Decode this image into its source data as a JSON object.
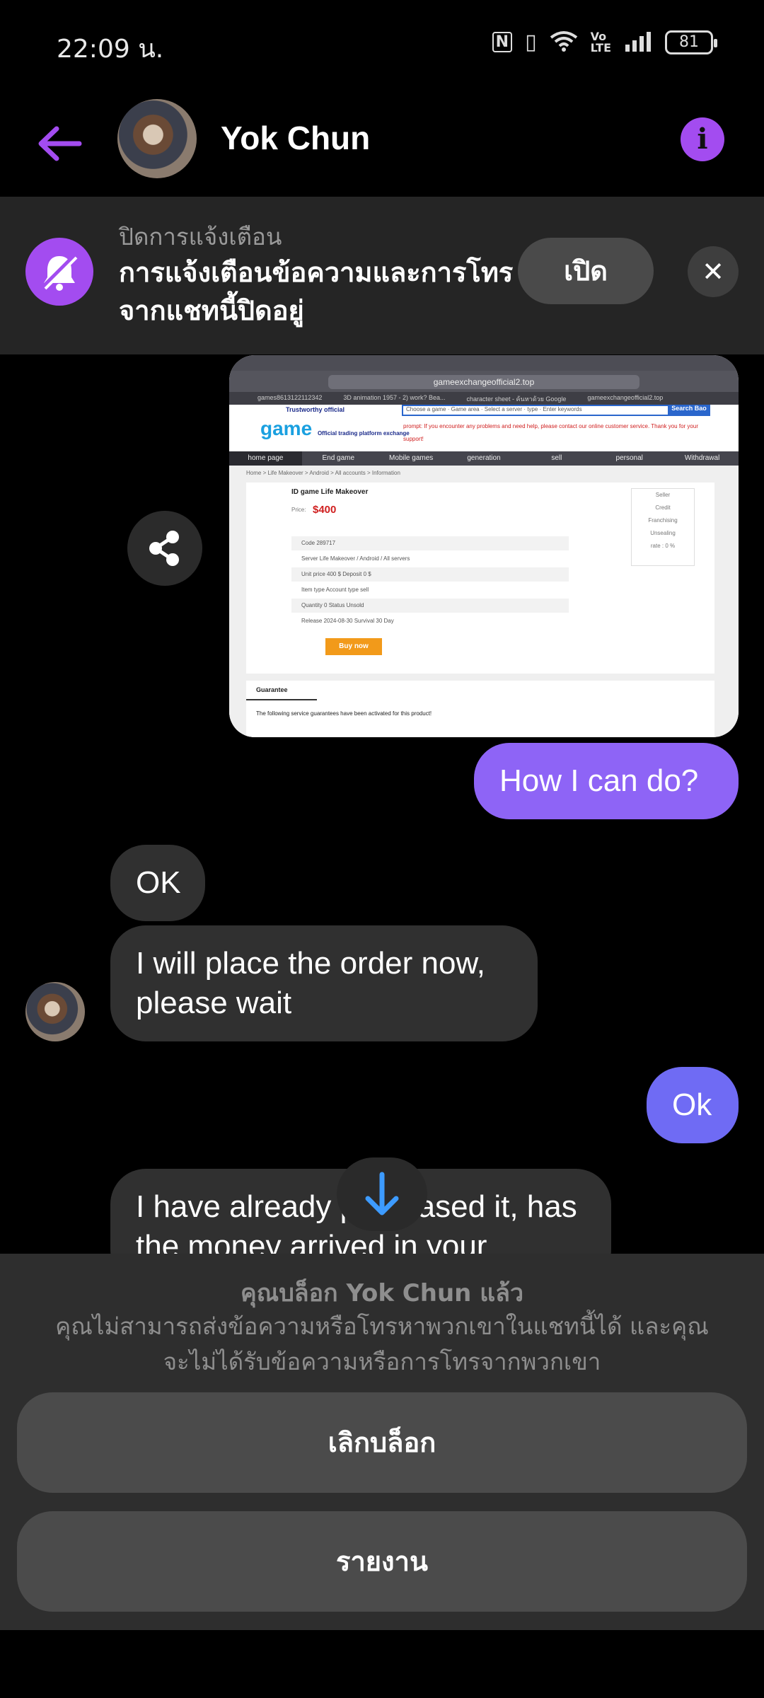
{
  "status": {
    "time": "22:09 น.",
    "battery": "81"
  },
  "header": {
    "contact_name": "Yok Chun"
  },
  "banner": {
    "title": "ปิดการแจ้งเตือน",
    "body": "การแจ้งเตือนข้อความและการโทรจากแชทนี้ปิดอยู่",
    "open_label": "เปิด"
  },
  "attachment": {
    "url": "gameexchangeofficial2.top",
    "tabs": [
      "games8613122112342",
      "3D animation 1957 - 2) work? Bea...",
      "character sheet - ค้นหาด้วย Google",
      "gameexchangeofficial2.top"
    ],
    "tagline": "Trustworthy official",
    "logo": "game",
    "logo_sub": "Official trading platform exchange",
    "search_fields": [
      "Choose a game",
      "Game area",
      "Select a server",
      "type",
      "Enter keywords"
    ],
    "search_button": "Search  Bao",
    "notice": "prompt: If you encounter any problems and need help, please contact our online customer service. Thank you for your support!",
    "nav": [
      "home page",
      "End game",
      "Mobile games",
      "generation",
      "sell",
      "personal",
      "Withdrawal"
    ],
    "breadcrumb": "Home > Life Makeover > Android > All accounts > Information",
    "product_name": "ID game Life Makeover",
    "price_label": "Price:",
    "price": "$400",
    "rows": [
      "Code      289717",
      "Server     Life Makeover / Android / All servers",
      "Unit price   400 $                         Deposit    0 $",
      "Item type   Account                     type      sell",
      "Quantity    0                             Status     Unsold",
      "Release    2024-08-30                  Survival   30 Day"
    ],
    "buy_label": "Buy now",
    "seller_lines": [
      "Seller",
      "Credit",
      "Franchising",
      "Unsealing",
      "rate : 0 %"
    ],
    "guarantee_tab": "Guarantee",
    "guarantee_text": "The following service guarantees have been activated for this product!"
  },
  "messages": [
    {
      "from": "me",
      "text": "How I can do?"
    },
    {
      "from": "them",
      "text": "OK"
    },
    {
      "from": "them",
      "text": "I will place the order now, please wait"
    },
    {
      "from": "me",
      "text": "Ok"
    },
    {
      "from": "them",
      "text": "I have already purchased it, has the money arrived in your"
    }
  ],
  "blocked": {
    "title": "คุณบล็อก Yok Chun แล้ว",
    "desc": "คุณไม่สามารถส่งข้อความหรือโทรหาพวกเขาในแชทนี้ได้ และคุณจะไม่ได้รับข้อความหรือการโทรจากพวกเขา",
    "unblock_label": "เลิกบล็อก",
    "report_label": "รายงาน"
  },
  "colors": {
    "accent": "#a34cf0",
    "outgoing": "#8e64f6",
    "incoming": "#303030"
  }
}
